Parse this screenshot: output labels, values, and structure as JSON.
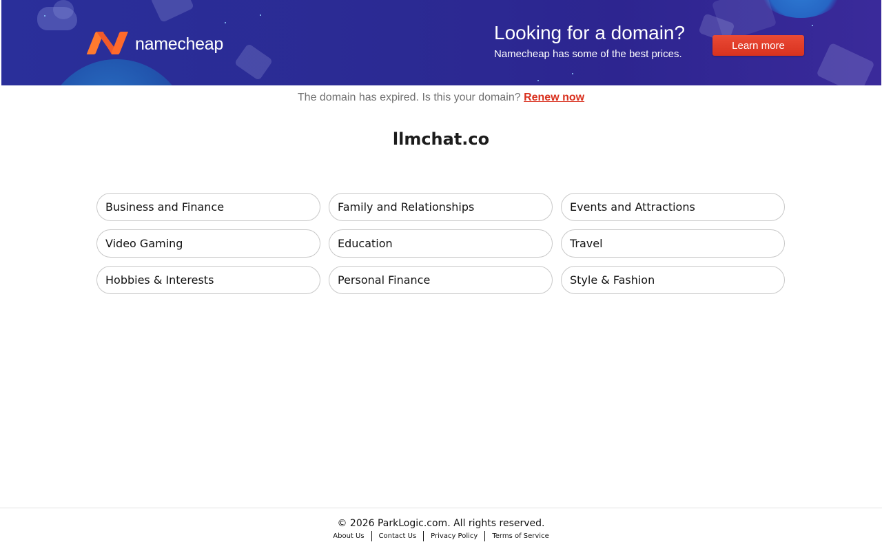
{
  "banner": {
    "brand_name": "namecheap",
    "promo_title": "Looking for a domain?",
    "promo_subtitle": "Namecheap has some of the best prices.",
    "cta_label": "Learn more",
    "colors": {
      "background": "#2b2a93",
      "logo_orange": "#f4572c",
      "cta_red": "#de3a25"
    }
  },
  "notice": {
    "text": "The domain has expired. Is this your domain?",
    "link_label": "Renew now"
  },
  "domain": {
    "name": "llmchat.co"
  },
  "categories": [
    "Business and Finance",
    "Family and Relationships",
    "Events and Attractions",
    "Video Gaming",
    "Education",
    "Travel",
    "Hobbies & Interests",
    "Personal Finance",
    "Style & Fashion"
  ],
  "footer": {
    "copyright": "© 2026 ParkLogic.com. All rights reserved.",
    "links": [
      "About Us",
      "Contact Us",
      "Privacy Policy",
      "Terms of Service"
    ]
  }
}
